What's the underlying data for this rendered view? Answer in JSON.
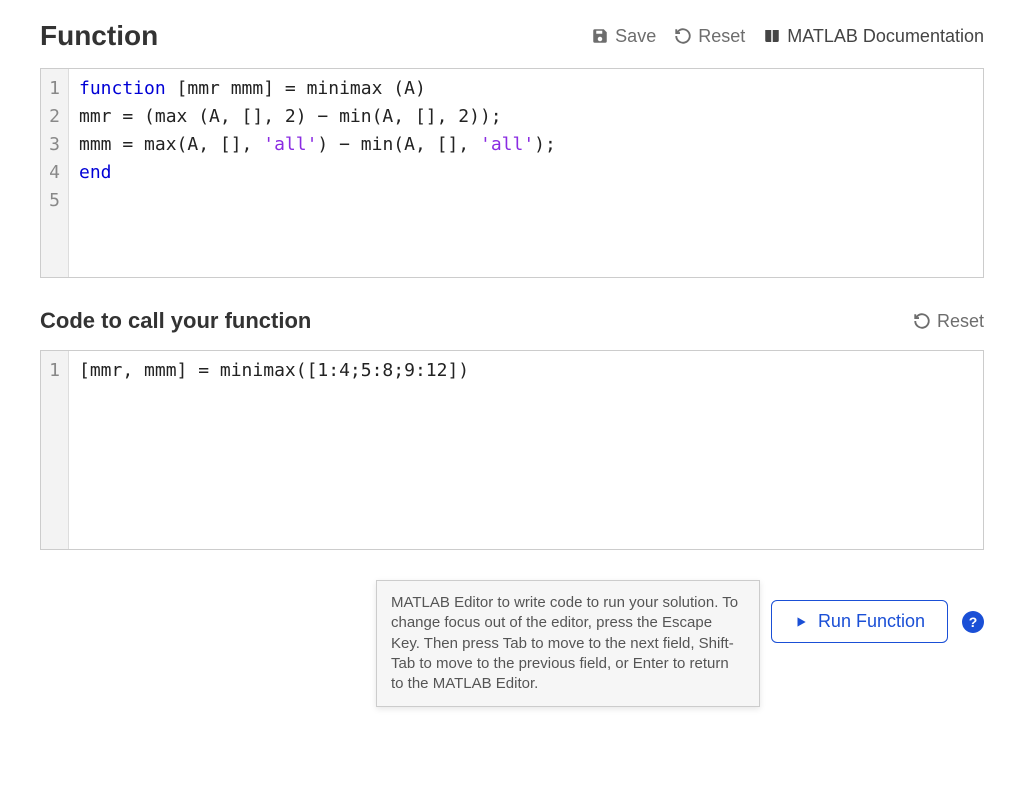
{
  "header1": {
    "title": "Function",
    "save": "Save",
    "reset": "Reset",
    "doc": "MATLAB Documentation"
  },
  "editor1": {
    "lines": [
      {
        "n": "1",
        "tokens": [
          [
            "k",
            "function"
          ],
          [
            "",
            " [mmr mmm] = minimax (A)"
          ]
        ]
      },
      {
        "n": "2",
        "tokens": [
          [
            "",
            "mmr = (max (A, [], 2) − min(A, [], 2));"
          ]
        ]
      },
      {
        "n": "3",
        "tokens": [
          [
            "",
            "mmm = max(A, [], "
          ],
          [
            "s",
            "'all'"
          ],
          [
            "",
            ") − min(A, [], "
          ],
          [
            "s",
            "'all'"
          ],
          [
            "",
            ");"
          ]
        ]
      },
      {
        "n": "4",
        "tokens": [
          [
            "k",
            "end"
          ]
        ]
      },
      {
        "n": "5",
        "tokens": [
          [
            "",
            ""
          ]
        ]
      }
    ]
  },
  "header2": {
    "title": "Code to call your function",
    "reset": "Reset"
  },
  "editor2": {
    "lines": [
      {
        "n": "1",
        "tokens": [
          [
            "",
            "[mmr, mmm] = minimax([1:4;5:8;9:12])"
          ]
        ]
      }
    ]
  },
  "tooltip": "MATLAB Editor to write code to run your solution. To change focus out of the editor, press the Escape Key. Then press Tab to move to the next field, Shift-Tab to move to the previous field, or Enter to return to the MATLAB Editor.",
  "footer": {
    "run": "Run Function",
    "help": "?"
  }
}
